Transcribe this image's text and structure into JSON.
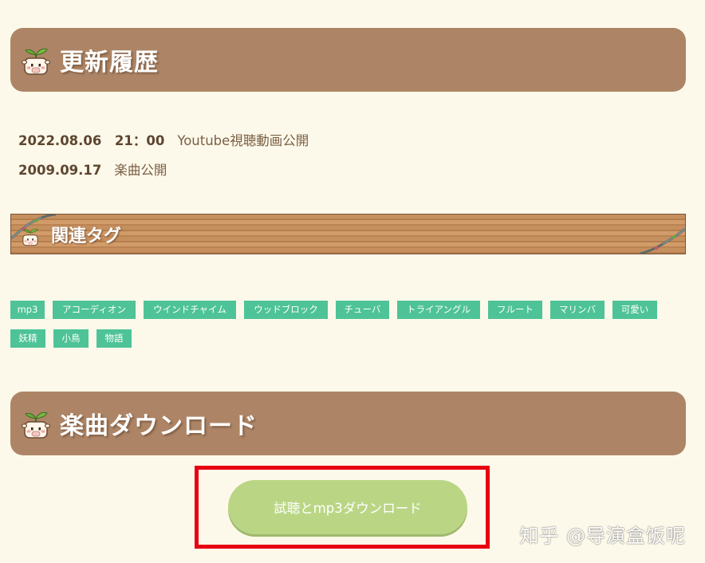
{
  "sections": {
    "history_title": "更新履歴",
    "tags_title": "関連タグ",
    "download_title": "楽曲ダウンロード"
  },
  "history": [
    {
      "date": "2022.08.06　21：00",
      "text": "Youtube視聴動画公開"
    },
    {
      "date": "2009.09.17",
      "text": "楽曲公開"
    }
  ],
  "tags": [
    "mp3",
    "アコーディオン",
    "ウインドチャイム",
    "ウッドブロック",
    "チューバ",
    "トライアングル",
    "フルート",
    "マリンバ",
    "可愛い",
    "妖精",
    "小鳥",
    "物語"
  ],
  "download": {
    "button_label": "試聴とmp3ダウンロード"
  },
  "watermark": "知乎 @导演盒饭呢",
  "colors": {
    "page_background": "#fdf9ea",
    "header_bar": "#ad8566",
    "tag_green": "#4ec397",
    "download_button": "#bad685",
    "highlight_box": "#e60012"
  }
}
